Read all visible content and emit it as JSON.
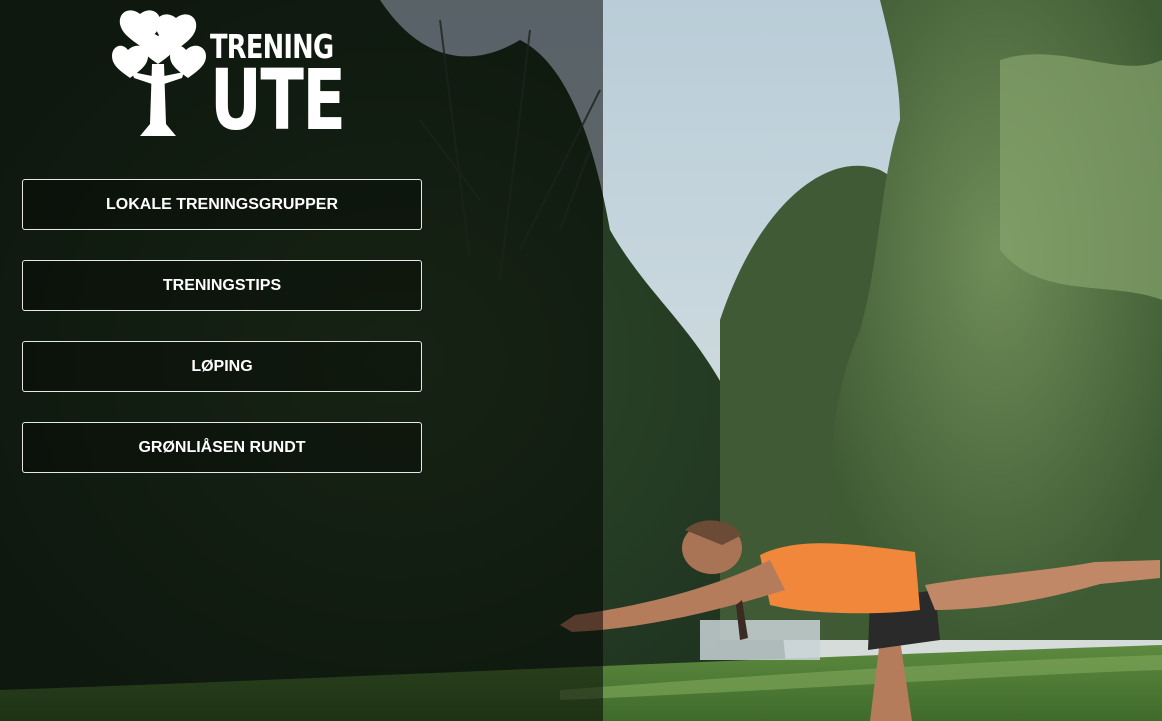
{
  "logo": {
    "line1": "TRENING",
    "line2": "UTE"
  },
  "menu": {
    "items": [
      {
        "label": "LOKALE TRENINGSGRUPPER"
      },
      {
        "label": "TRENINGSTIPS"
      },
      {
        "label": "LØPING"
      },
      {
        "label": "GRØNLIÅSEN RUNDT"
      }
    ]
  },
  "colors": {
    "button_border": "#ffffff",
    "button_text": "#ffffff",
    "logo": "#ffffff",
    "overlay": "#000000",
    "shirt_accent": "#f0873a"
  }
}
